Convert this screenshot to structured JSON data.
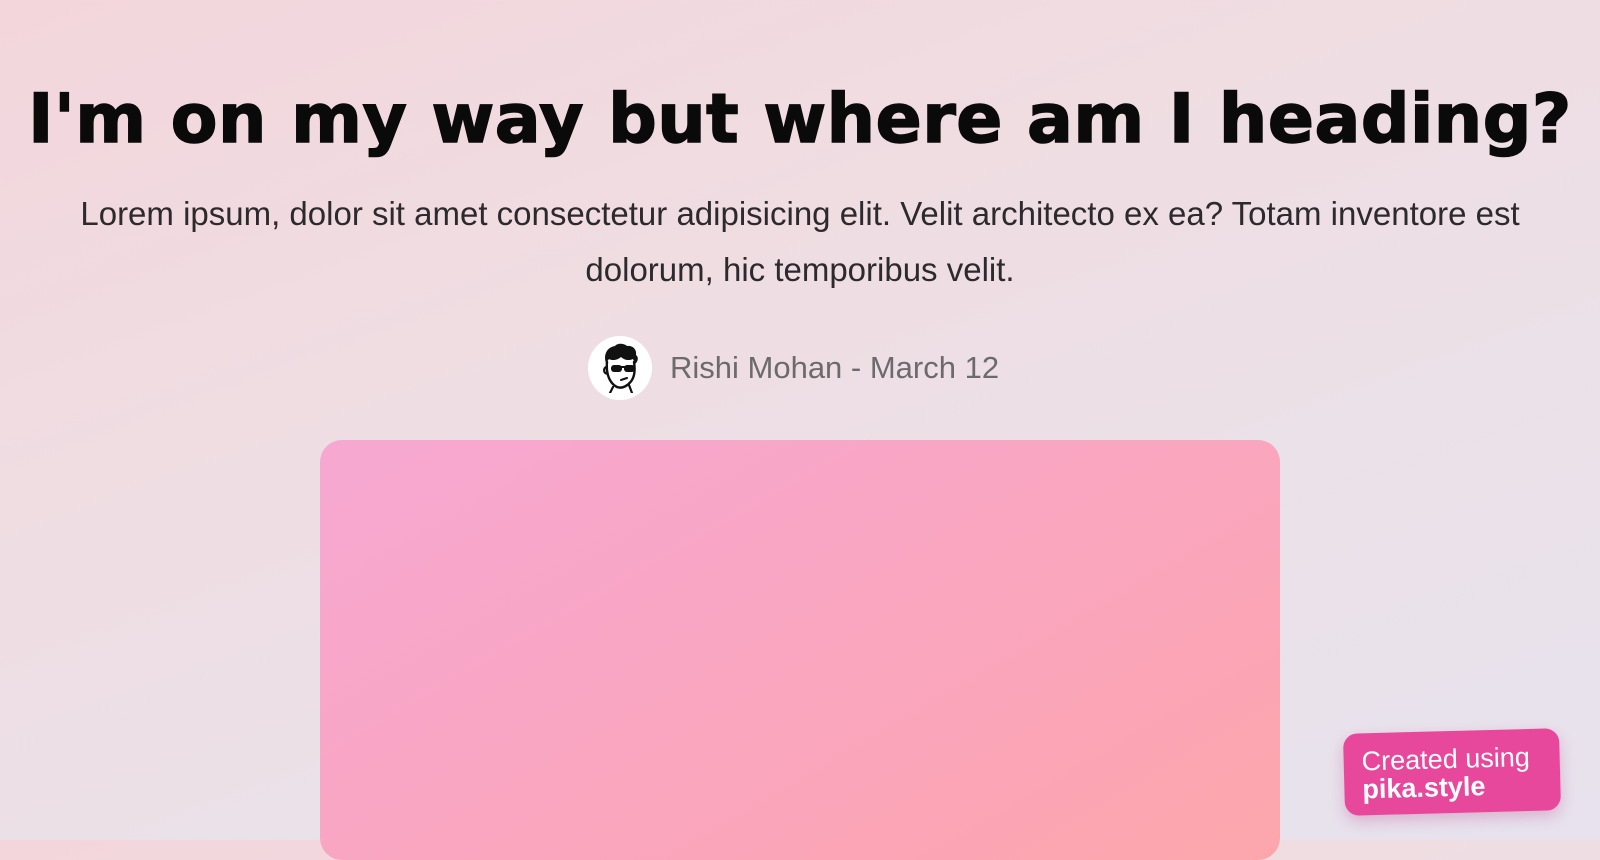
{
  "post": {
    "title": "I'm on my way but where am I heading?",
    "subtitle": "Lorem ipsum, dolor sit amet consectetur adipisicing elit. Velit architecto ex ea? Totam inventore est dolorum, hic temporibus velit.",
    "byline": "Rishi Mohan - March 12",
    "avatar_icon": "cartoon-face-sunglasses-icon"
  },
  "badge": {
    "line1": "Created using",
    "line2": "pika.style"
  },
  "colors": {
    "title": "#0a0a0a",
    "subtitle": "#2c2a2c",
    "byline": "#6c6a6c",
    "hero_gradient_start": "#f7a8d2",
    "hero_gradient_end": "#fca6ac",
    "badge_background": "#e8489c"
  }
}
